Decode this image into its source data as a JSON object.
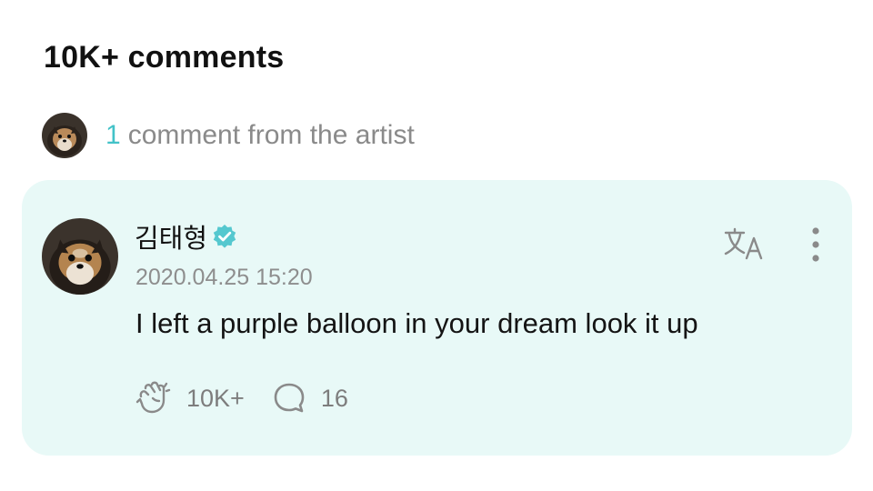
{
  "comments_header": {
    "title": "10K+ comments"
  },
  "artist_summary": {
    "count": "1",
    "text": "comment from the artist",
    "count_color": "#43c2c8"
  },
  "comment": {
    "author": "김태형",
    "verified": true,
    "timestamp": "2020.04.25 15:20",
    "body": "I left a purple balloon in your dream look it up",
    "like_count": "10K+",
    "reply_count": "16",
    "card_background": "#e8f9f7",
    "icons": {
      "verified": "verified-badge-icon",
      "translate": "translate-icon",
      "more": "more-vertical-icon",
      "like": "cheer-hand-icon",
      "reply": "speech-bubble-icon"
    }
  }
}
